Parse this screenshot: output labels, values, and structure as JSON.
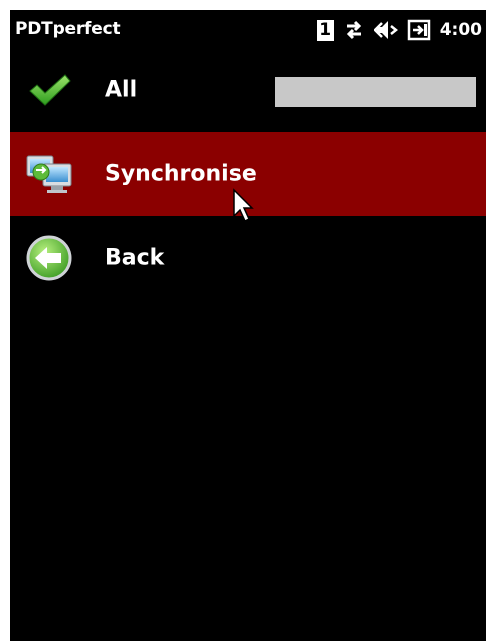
{
  "statusbar": {
    "app_title": "PDTperfect",
    "sim_slot": "1",
    "clock": "4:00",
    "icons": [
      "sim-slot-icon",
      "data-transfer-icon",
      "speaker-muted-icon",
      "power-plugged-icon"
    ]
  },
  "menu": {
    "items": [
      {
        "label": "All",
        "icon": "checkmark-icon",
        "progress": 0
      },
      {
        "label": "Synchronise",
        "icon": "sync-computer-icon",
        "selected": true
      },
      {
        "label": "Back",
        "icon": "back-arrow-icon"
      }
    ]
  },
  "colors": {
    "background": "#000000",
    "selection": "#8b0000",
    "text": "#ffffff",
    "progress_track": "#c8c8c8"
  }
}
